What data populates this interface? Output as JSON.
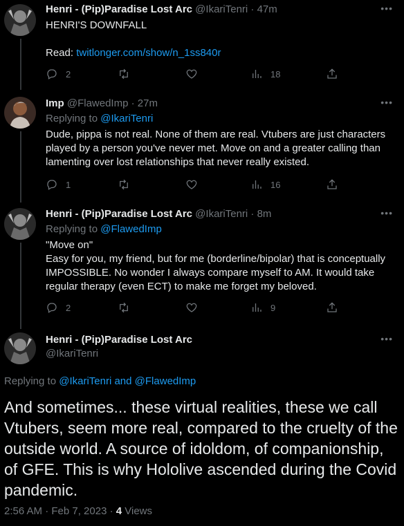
{
  "tweets": [
    {
      "name": "Henri - (Pip)Paradise Lost Arc",
      "handle": "@IkariTenri",
      "time": "47m",
      "line1": "HENRI'S DOWNFALL",
      "read_label": "Read: ",
      "read_link": "twitlonger.com/show/n_1ss840r",
      "replies": "2",
      "views": "18"
    },
    {
      "name": "Imp",
      "handle": "@FlawedImp",
      "time": "27m",
      "replying_label": "Replying to ",
      "replying_to": "@IkariTenri",
      "text": "Dude, pippa is not real. None of them are real. Vtubers are just characters played by a person you've never met. Move on and a greater calling than lamenting over lost relationships that never really existed.",
      "replies": "1",
      "views": "16"
    },
    {
      "name": "Henri - (Pip)Paradise Lost Arc",
      "handle": "@IkariTenri",
      "time": "8m",
      "replying_label": "Replying to ",
      "replying_to": "@FlawedImp",
      "line1": "\"Move on\"",
      "text": "Easy for you, my friend, but for me (borderline/bipolar) that is conceptually IMPOSSIBLE. No wonder I always compare myself to AM. It would take regular therapy (even ECT) to make me forget my beloved.",
      "replies": "2",
      "views": "9"
    }
  ],
  "main": {
    "name": "Henri - (Pip)Paradise Lost Arc",
    "handle": "@IkariTenri",
    "replying_label": "Replying to ",
    "replying_to_1": "@IkariTenri",
    "and": " and ",
    "replying_to_2": "@FlawedImp",
    "text": "And sometimes... these virtual realities, these we call Vtubers, seem more real, compared to the cruelty of the outside world. A source of idoldom, of companionship, of GFE. This is why Hololive ascended during the Covid pandemic.",
    "timestamp": "2:56 AM · Feb 7, 2023 · ",
    "views_count": "4",
    "views_label": " Views"
  },
  "icons": [
    "reply-icon",
    "retweet-icon",
    "like-icon",
    "views-icon",
    "share-icon",
    "more-icon"
  ],
  "colors": {
    "background": "#000000",
    "text": "#e7e9ea",
    "muted": "#71767b",
    "link": "#1d9bf0"
  }
}
